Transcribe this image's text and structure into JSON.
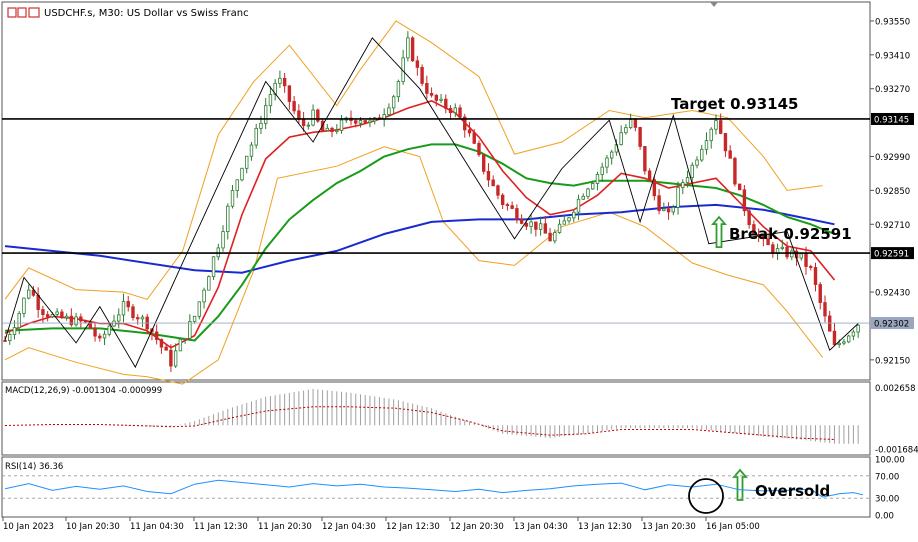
{
  "header": {
    "symbol": "USDCHF.s",
    "timeframe": "M30",
    "description": "US Dollar vs Swiss Franc"
  },
  "colors": {
    "bull_candle": "#2e7d32",
    "bear_candle": "#c62828",
    "bollinger": "#f0a020",
    "ma_fast": "#e02020",
    "ma_mid": "#1a9a1a",
    "ma_slow": "#1a2ad0",
    "zigzag": "#000000",
    "macd_hist": "#a0a0a0",
    "macd_signal": "#c00000",
    "rsi_line": "#1e90ff",
    "arrow": "#2e9e2e"
  },
  "annotations": {
    "target": "Target 0.93145",
    "break": "Break 0.92591",
    "oversold": "Oversold"
  },
  "chart_data": [
    {
      "type": "candlestick",
      "title": "USDCHF.s, M30: US Dollar vs Swiss Franc",
      "ylim": [
        0.92075,
        0.9362
      ],
      "y_ticks": [
        "0.93550",
        "0.93410",
        "0.93270",
        "0.92990",
        "0.92850",
        "0.92710",
        "0.92430",
        "0.92150"
      ],
      "price_labels": {
        "target": "0.93145",
        "break": "0.92591",
        "current": "0.92302"
      },
      "levels": {
        "target": 0.93145,
        "break": 0.92591,
        "current": 0.92302
      },
      "x_ticks": [
        "10 Jan 2023",
        "10 Jan 20:30",
        "11 Jan 04:30",
        "11 Jan 12:30",
        "11 Jan 20:30",
        "12 Jan 04:30",
        "12 Jan 12:30",
        "12 Jan 20:30",
        "13 Jan 04:30",
        "13 Jan 12:30",
        "13 Jan 20:30",
        "16 Jan 05:00"
      ],
      "close_path": [
        [
          0,
          0.9223
        ],
        [
          5,
          0.9232
        ],
        [
          10,
          0.9245
        ],
        [
          15,
          0.9236
        ],
        [
          20,
          0.9233
        ],
        [
          25,
          0.9232
        ],
        [
          30,
          0.9231
        ],
        [
          35,
          0.923
        ],
        [
          40,
          0.9222
        ],
        [
          45,
          0.9231
        ],
        [
          50,
          0.9237
        ],
        [
          55,
          0.9234
        ],
        [
          60,
          0.923
        ],
        [
          65,
          0.9222
        ],
        [
          70,
          0.9214
        ],
        [
          75,
          0.9224
        ],
        [
          80,
          0.9233
        ],
        [
          85,
          0.9248
        ],
        [
          90,
          0.9263
        ],
        [
          95,
          0.9281
        ],
        [
          100,
          0.9296
        ],
        [
          105,
          0.9306
        ],
        [
          110,
          0.932
        ],
        [
          115,
          0.9332
        ],
        [
          120,
          0.9322
        ],
        [
          125,
          0.9311
        ],
        [
          130,
          0.9316
        ],
        [
          135,
          0.9308
        ],
        [
          140,
          0.9311
        ],
        [
          145,
          0.9314
        ],
        [
          150,
          0.9315
        ],
        [
          155,
          0.9312
        ],
        [
          160,
          0.9318
        ],
        [
          165,
          0.9326
        ],
        [
          170,
          0.9346
        ],
        [
          175,
          0.9332
        ],
        [
          180,
          0.9323
        ],
        [
          185,
          0.932
        ],
        [
          190,
          0.9318
        ],
        [
          195,
          0.931
        ],
        [
          200,
          0.9298
        ],
        [
          205,
          0.9288
        ],
        [
          210,
          0.928
        ],
        [
          215,
          0.9276
        ],
        [
          220,
          0.9272
        ],
        [
          225,
          0.927
        ],
        [
          230,
          0.9265
        ],
        [
          235,
          0.927
        ],
        [
          240,
          0.9278
        ],
        [
          245,
          0.9286
        ],
        [
          250,
          0.9292
        ],
        [
          255,
          0.9299
        ],
        [
          260,
          0.9309
        ],
        [
          265,
          0.9314
        ],
        [
          270,
          0.9294
        ],
        [
          275,
          0.928
        ],
        [
          280,
          0.9274
        ],
        [
          285,
          0.9287
        ],
        [
          290,
          0.9295
        ],
        [
          295,
          0.9306
        ],
        [
          300,
          0.9315
        ],
        [
          305,
          0.93
        ],
        [
          310,
          0.9283
        ],
        [
          315,
          0.927
        ],
        [
          320,
          0.9263
        ],
        [
          325,
          0.926
        ],
        [
          330,
          0.9259
        ],
        [
          335,
          0.9258
        ],
        [
          340,
          0.9252
        ],
        [
          345,
          0.9235
        ],
        [
          350,
          0.922
        ],
        [
          355,
          0.9225
        ],
        [
          360,
          0.923
        ]
      ],
      "zigzag": [
        [
          0,
          0.9223
        ],
        [
          8,
          0.9249
        ],
        [
          30,
          0.9222
        ],
        [
          40,
          0.9237
        ],
        [
          55,
          0.9212
        ],
        [
          80,
          0.9266
        ],
        [
          110,
          0.933
        ],
        [
          130,
          0.9305
        ],
        [
          155,
          0.9348
        ],
        [
          175,
          0.9327
        ],
        [
          200,
          0.9288
        ],
        [
          215,
          0.9265
        ],
        [
          235,
          0.9294
        ],
        [
          255,
          0.9314
        ],
        [
          268,
          0.9272
        ],
        [
          282,
          0.9316
        ],
        [
          297,
          0.9263
        ],
        [
          330,
          0.9268
        ],
        [
          348,
          0.9219
        ],
        [
          360,
          0.923
        ]
      ],
      "bb_upper": [
        [
          0,
          0.924
        ],
        [
          10,
          0.9253
        ],
        [
          30,
          0.9244
        ],
        [
          50,
          0.9243
        ],
        [
          60,
          0.924
        ],
        [
          75,
          0.926
        ],
        [
          90,
          0.9308
        ],
        [
          105,
          0.933
        ],
        [
          120,
          0.9345
        ],
        [
          140,
          0.932
        ],
        [
          150,
          0.9335
        ],
        [
          165,
          0.9355
        ],
        [
          180,
          0.9346
        ],
        [
          200,
          0.9332
        ],
        [
          215,
          0.93
        ],
        [
          235,
          0.9305
        ],
        [
          255,
          0.9318
        ],
        [
          270,
          0.9315
        ],
        [
          290,
          0.9318
        ],
        [
          305,
          0.9315
        ],
        [
          320,
          0.9299
        ],
        [
          330,
          0.9285
        ],
        [
          345,
          0.9287
        ]
      ],
      "bb_lower": [
        [
          0,
          0.9215
        ],
        [
          10,
          0.922
        ],
        [
          30,
          0.9214
        ],
        [
          50,
          0.9209
        ],
        [
          60,
          0.9208
        ],
        [
          75,
          0.9205
        ],
        [
          90,
          0.9215
        ],
        [
          105,
          0.9252
        ],
        [
          115,
          0.929
        ],
        [
          140,
          0.9295
        ],
        [
          160,
          0.9303
        ],
        [
          175,
          0.9299
        ],
        [
          185,
          0.9272
        ],
        [
          200,
          0.9256
        ],
        [
          215,
          0.9254
        ],
        [
          235,
          0.927
        ],
        [
          255,
          0.9276
        ],
        [
          270,
          0.927
        ],
        [
          290,
          0.9255
        ],
        [
          305,
          0.925
        ],
        [
          320,
          0.9246
        ],
        [
          330,
          0.9235
        ],
        [
          345,
          0.9216
        ]
      ],
      "ma_fast": [
        [
          0,
          0.9226
        ],
        [
          10,
          0.923
        ],
        [
          20,
          0.9233
        ],
        [
          30,
          0.9232
        ],
        [
          40,
          0.923
        ],
        [
          50,
          0.923
        ],
        [
          60,
          0.9227
        ],
        [
          70,
          0.922
        ],
        [
          80,
          0.9225
        ],
        [
          90,
          0.9245
        ],
        [
          100,
          0.9275
        ],
        [
          110,
          0.9298
        ],
        [
          120,
          0.9307
        ],
        [
          130,
          0.9309
        ],
        [
          140,
          0.931
        ],
        [
          150,
          0.9312
        ],
        [
          160,
          0.9315
        ],
        [
          170,
          0.9319
        ],
        [
          180,
          0.9322
        ],
        [
          190,
          0.9317
        ],
        [
          200,
          0.9307
        ],
        [
          210,
          0.9293
        ],
        [
          220,
          0.9282
        ],
        [
          230,
          0.9275
        ],
        [
          240,
          0.9277
        ],
        [
          250,
          0.9283
        ],
        [
          260,
          0.9292
        ],
        [
          270,
          0.929
        ],
        [
          280,
          0.9286
        ],
        [
          290,
          0.9288
        ],
        [
          300,
          0.929
        ],
        [
          310,
          0.928
        ],
        [
          320,
          0.927
        ],
        [
          330,
          0.9262
        ],
        [
          340,
          0.926
        ],
        [
          350,
          0.9248
        ]
      ],
      "ma_mid": [
        [
          0,
          0.9227
        ],
        [
          20,
          0.9228
        ],
        [
          40,
          0.9228
        ],
        [
          60,
          0.9226
        ],
        [
          80,
          0.9223
        ],
        [
          90,
          0.9233
        ],
        [
          100,
          0.9246
        ],
        [
          110,
          0.9261
        ],
        [
          120,
          0.9273
        ],
        [
          130,
          0.9281
        ],
        [
          140,
          0.9288
        ],
        [
          150,
          0.9293
        ],
        [
          160,
          0.9299
        ],
        [
          170,
          0.9302
        ],
        [
          180,
          0.9304
        ],
        [
          190,
          0.9304
        ],
        [
          200,
          0.9301
        ],
        [
          210,
          0.9296
        ],
        [
          220,
          0.929
        ],
        [
          230,
          0.9288
        ],
        [
          240,
          0.9287
        ],
        [
          250,
          0.9289
        ],
        [
          260,
          0.9289
        ],
        [
          270,
          0.9289
        ],
        [
          280,
          0.9288
        ],
        [
          290,
          0.9287
        ],
        [
          300,
          0.9286
        ],
        [
          310,
          0.9283
        ],
        [
          320,
          0.9279
        ],
        [
          330,
          0.9274
        ],
        [
          340,
          0.9271
        ],
        [
          350,
          0.9267
        ]
      ],
      "ma_slow": [
        [
          0,
          0.9262
        ],
        [
          40,
          0.9258
        ],
        [
          80,
          0.9252
        ],
        [
          100,
          0.9251
        ],
        [
          120,
          0.9256
        ],
        [
          140,
          0.926
        ],
        [
          160,
          0.9267
        ],
        [
          180,
          0.9272
        ],
        [
          200,
          0.9273
        ],
        [
          220,
          0.9273
        ],
        [
          240,
          0.9275
        ],
        [
          260,
          0.9276
        ],
        [
          280,
          0.9278
        ],
        [
          300,
          0.9279
        ],
        [
          320,
          0.9277
        ],
        [
          340,
          0.9273
        ],
        [
          350,
          0.9271
        ]
      ]
    },
    {
      "type": "bar",
      "title": "MACD(12,26,9) -0.001304 -0.000999",
      "y_ticks": [
        "0.002658",
        "-0.001684"
      ],
      "ylim": [
        -0.00195,
        0.0029
      ],
      "histogram": [
        [
          0,
          -3e-05
        ],
        [
          20,
          3e-05
        ],
        [
          40,
          0.0
        ],
        [
          55,
          -8e-05
        ],
        [
          70,
          -0.00012
        ],
        [
          80,
          0.0003
        ],
        [
          95,
          0.0012
        ],
        [
          110,
          0.002
        ],
        [
          130,
          0.00255
        ],
        [
          145,
          0.0023
        ],
        [
          165,
          0.0018
        ],
        [
          180,
          0.0012
        ],
        [
          195,
          0.0003
        ],
        [
          210,
          -0.0006
        ],
        [
          230,
          -0.0009
        ],
        [
          245,
          -0.0006
        ],
        [
          260,
          -0.0002
        ],
        [
          275,
          -0.0002
        ],
        [
          290,
          -0.0002
        ],
        [
          305,
          -0.0005
        ],
        [
          320,
          -0.0008
        ],
        [
          335,
          -0.001
        ],
        [
          350,
          -0.0013
        ]
      ],
      "signal": [
        [
          0,
          -2e-05
        ],
        [
          20,
          5e-05
        ],
        [
          40,
          5e-05
        ],
        [
          55,
          -2e-05
        ],
        [
          70,
          -0.0001
        ],
        [
          80,
          -5e-05
        ],
        [
          95,
          0.0005
        ],
        [
          110,
          0.001
        ],
        [
          130,
          0.0013
        ],
        [
          145,
          0.0013
        ],
        [
          165,
          0.0012
        ],
        [
          180,
          0.0009
        ],
        [
          195,
          0.0003
        ],
        [
          210,
          -0.0004
        ],
        [
          230,
          -0.0007
        ],
        [
          245,
          -0.0006
        ],
        [
          260,
          -0.0003
        ],
        [
          275,
          -0.0003
        ],
        [
          290,
          -0.0003
        ],
        [
          305,
          -0.0005
        ],
        [
          320,
          -0.0007
        ],
        [
          335,
          -0.0009
        ],
        [
          350,
          -0.001
        ]
      ]
    },
    {
      "type": "line",
      "title": "RSI(14) 36.36",
      "ylim": [
        0,
        100
      ],
      "y_ticks": [
        "100.00",
        "70.00",
        "30.00",
        "0.00"
      ],
      "levels": [
        70,
        30
      ],
      "rsi": [
        [
          0,
          47
        ],
        [
          10,
          56
        ],
        [
          20,
          44
        ],
        [
          30,
          51
        ],
        [
          40,
          46
        ],
        [
          50,
          52
        ],
        [
          60,
          42
        ],
        [
          70,
          38
        ],
        [
          80,
          55
        ],
        [
          90,
          62
        ],
        [
          100,
          58
        ],
        [
          110,
          54
        ],
        [
          120,
          50
        ],
        [
          130,
          56
        ],
        [
          140,
          52
        ],
        [
          150,
          55
        ],
        [
          160,
          50
        ],
        [
          170,
          48
        ],
        [
          180,
          45
        ],
        [
          190,
          42
        ],
        [
          200,
          46
        ],
        [
          210,
          40
        ],
        [
          220,
          44
        ],
        [
          230,
          47
        ],
        [
          240,
          52
        ],
        [
          250,
          55
        ],
        [
          260,
          57
        ],
        [
          270,
          45
        ],
        [
          280,
          54
        ],
        [
          290,
          50
        ],
        [
          300,
          55
        ],
        [
          310,
          45
        ],
        [
          320,
          43
        ],
        [
          330,
          44
        ],
        [
          340,
          46
        ],
        [
          345,
          32
        ],
        [
          352,
          38
        ],
        [
          358,
          40
        ],
        [
          362,
          36
        ]
      ]
    }
  ]
}
